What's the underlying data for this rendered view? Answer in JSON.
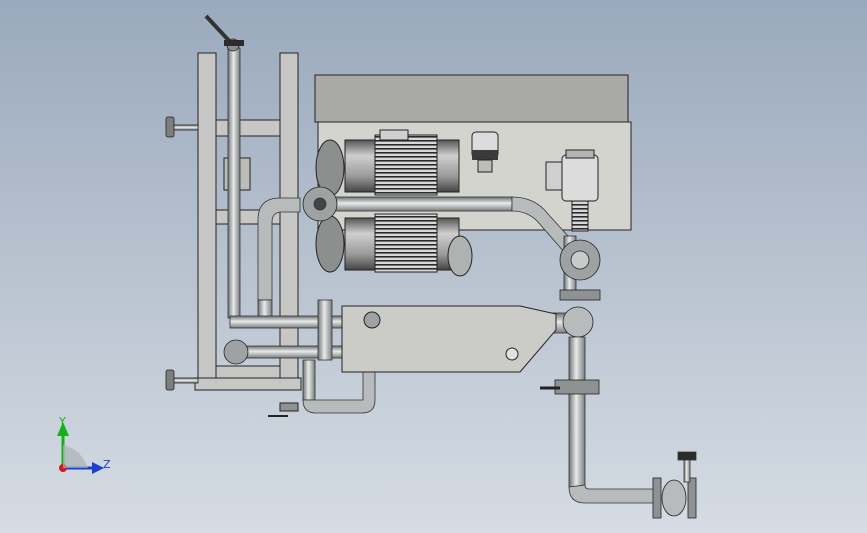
{
  "viewport": {
    "background_top": "#9aa9bd",
    "background_bottom": "#d6dce3"
  },
  "model": {
    "metal_color": "#b8bbbc",
    "frame_color": "#c7c8c6",
    "panel_color": "#d4d4cf",
    "cover_color": "#a9aaa6",
    "outline_color": "#1f1f1f",
    "dark_metal_color": "#2b2b2b"
  },
  "triad": {
    "y_label": "Y",
    "z_label": "Z",
    "y_color": "#18b018",
    "z_color": "#1a3fd1",
    "x_color": "#d11a1a"
  }
}
